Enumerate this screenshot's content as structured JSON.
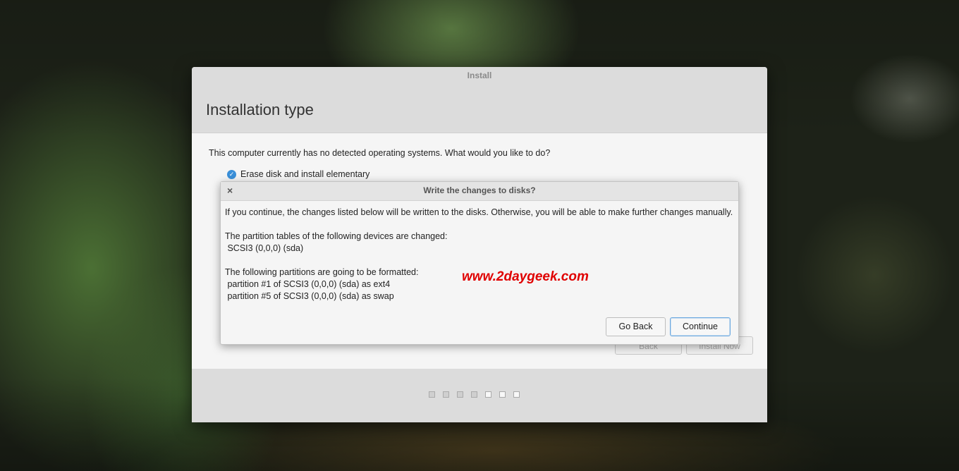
{
  "window": {
    "title": "Install",
    "heading": "Installation type",
    "question": "This computer currently has no detected operating systems. What would you like to do?",
    "option_erase": "Erase disk and install elementary",
    "back_label": "Back",
    "install_label": "Install Now"
  },
  "progress": {
    "total_steps": 7,
    "completed_steps": 4
  },
  "dialog": {
    "title": "Write the changes to disks?",
    "close_symbol": "×",
    "intro": "If you continue, the changes listed below will be written to the disks. Otherwise, you will be able to make further changes manually.",
    "tables_heading": "The partition tables of the following devices are changed:",
    "tables_device": " SCSI3 (0,0,0) (sda)",
    "format_heading": "The following partitions are going to be formatted:",
    "format_1": " partition #1 of SCSI3 (0,0,0) (sda) as ext4",
    "format_2": " partition #5 of SCSI3 (0,0,0) (sda) as swap",
    "go_back_label": "Go Back",
    "continue_label": "Continue"
  },
  "watermark": "www.2daygeek.com",
  "colors": {
    "accent": "#3a8fd8",
    "watermark": "#e00000"
  }
}
